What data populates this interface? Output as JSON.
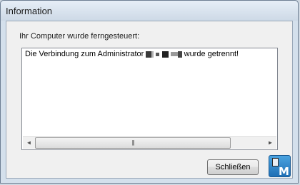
{
  "window": {
    "title": "Information"
  },
  "dialog": {
    "description": "Ihr Computer wurde ferngesteuert:",
    "message_prefix": "Die Verbindung zum Administrator",
    "message_suffix": "wurde getrennt!",
    "scroll_grip": "|||",
    "scroll_left": "◄",
    "scroll_right": "►"
  },
  "buttons": {
    "close_label": "Schließen"
  },
  "logo": {
    "letter": "M"
  }
}
